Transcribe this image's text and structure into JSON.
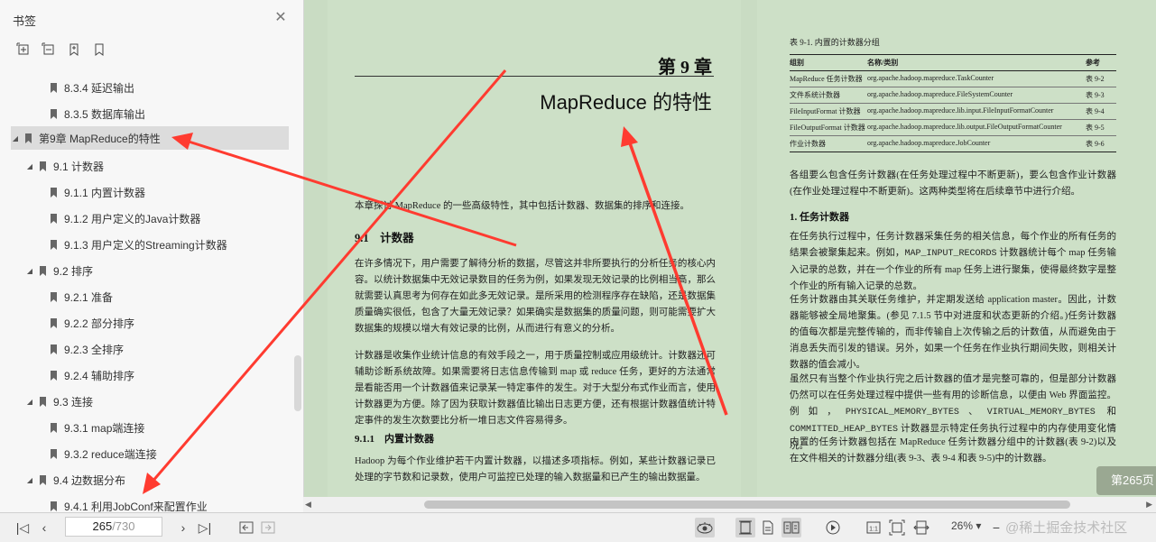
{
  "sidebar": {
    "title": "书签",
    "items": [
      {
        "label": "8.3.4 延迟输出",
        "level": 2,
        "expanded": null,
        "selected": false
      },
      {
        "label": "8.3.5 数据库输出",
        "level": 2,
        "expanded": null,
        "selected": false
      },
      {
        "label": "第9章 MapReduce的特性",
        "level": 0,
        "expanded": true,
        "selected": true
      },
      {
        "label": "9.1 计数器",
        "level": 1,
        "expanded": true,
        "selected": false
      },
      {
        "label": "9.1.1 内置计数器",
        "level": 2,
        "expanded": null,
        "selected": false
      },
      {
        "label": "9.1.2 用户定义的Java计数器",
        "level": 2,
        "expanded": null,
        "selected": false
      },
      {
        "label": "9.1.3 用户定义的Streaming计数器",
        "level": 2,
        "expanded": null,
        "selected": false
      },
      {
        "label": "9.2 排序",
        "level": 1,
        "expanded": true,
        "selected": false
      },
      {
        "label": "9.2.1 准备",
        "level": 2,
        "expanded": null,
        "selected": false
      },
      {
        "label": "9.2.2 部分排序",
        "level": 2,
        "expanded": null,
        "selected": false
      },
      {
        "label": "9.2.3 全排序",
        "level": 2,
        "expanded": null,
        "selected": false
      },
      {
        "label": "9.2.4 辅助排序",
        "level": 2,
        "expanded": null,
        "selected": false
      },
      {
        "label": "9.3 连接",
        "level": 1,
        "expanded": true,
        "selected": false
      },
      {
        "label": "9.3.1 map端连接",
        "level": 2,
        "expanded": null,
        "selected": false
      },
      {
        "label": "9.3.2 reduce端连接",
        "level": 2,
        "expanded": null,
        "selected": false
      },
      {
        "label": "9.4 边数据分布",
        "level": 1,
        "expanded": true,
        "selected": false
      },
      {
        "label": "9.4.1 利用JobConf来配置作业",
        "level": 2,
        "expanded": null,
        "selected": false
      }
    ]
  },
  "left_page": {
    "chapter_number": "第 9 章",
    "chapter_title": "MapReduce 的特性",
    "intro": "本章探讨 MapReduce 的一些高级特性，其中包括计数器、数据集的排序和连接。",
    "section_num": "9.1",
    "section_title": "计数器",
    "p1": "在许多情况下，用户需要了解待分析的数据，尽管这并非所要执行的分析任务的核心内容。以统计数据集中无效记录数目的任务为例，如果发现无效记录的比例相当高，那么就需要认真思考为何存在如此多无效记录。是所采用的检测程序存在缺陷，还是数据集质量确实很低，包含了大量无效记录？如果确实是数据集的质量问题，则可能需要扩大数据集的规模以增大有效记录的比例，从而进行有意义的分析。",
    "p2": "计数器是收集作业统计信息的有效手段之一，用于质量控制或应用级统计。计数器还可辅助诊断系统故障。如果需要将日志信息传输到 map 或 reduce 任务，更好的方法通常是看能否用一个计数器值来记录某一特定事件的发生。对于大型分布式作业而言，使用计数器更为方便。除了因为获取计数器值比输出日志更方便，还有根据计数器值统计特定事件的发生次数要比分析一堆日志文件容易得多。",
    "subsection_num": "9.1.1",
    "subsection_title": "内置计数器",
    "p3": "Hadoop 为每个作业维护若干内置计数器，以描述多项指标。例如，某些计数器记录已处理的字节数和记录数，使用户可监控已处理的输入数据量和已产生的输出数据量。"
  },
  "right_page": {
    "table_caption": "表 9-1. 内置的计数器分组",
    "table_headers": [
      "组别",
      "名称/类别",
      "参考"
    ],
    "table_rows": [
      [
        "MapReduce 任务计数器",
        "org.apache.hadoop.mapreduce.TaskCounter",
        "表 9-2"
      ],
      [
        "文件系统计数器",
        "org.apache.hadoop.mapreduce.FileSystemCounter",
        "表 9-3"
      ],
      [
        "FileInputFormat 计数器",
        "org.apache.hadoop.mapreduce.lib.input.FileInputFormatCounter",
        "表 9-4"
      ],
      [
        "FileOutputFormat 计数器",
        "org.apache.hadoop.mapreduce.lib.output.FileOutputFormatCounter",
        "表 9-5"
      ],
      [
        "作业计数器",
        "org.apache.hadoop.mapreduce.JobCounter",
        "表 9-6"
      ]
    ],
    "p1": "各组要么包含任务计数器(在任务处理过程中不断更新)，要么包含作业计数器(在作业处理过程中不断更新)。这两种类型将在后续章节中进行介绍。",
    "heading1": "1. 任务计数器",
    "p2a": "在任务执行过程中，任务计数器采集任务的相关信息，每个作业的所有任务的结果会被聚集起来。例如，",
    "p2_code": "MAP_INPUT_RECORDS",
    "p2b": " 计数器统计每个 map 任务输入记录的总数，并在一个作业的所有 map 任务上进行聚集，使得最终数字是整个作业的所有输入记录的总数。",
    "p3": "任务计数器由其关联任务维护，并定期发送给 application master。因此，计数器能够被全局地聚集。(参见 7.1.5 节中对进度和状态更新的介绍。)任务计数器的值每次都是完整传输的，而非传输自上次传输之后的计数值，从而避免由于消息丢失而引发的错误。另外，如果一个任务在作业执行期间失败，则相关计数器的值会减小。",
    "p4a": "虽然只有当整个作业执行完之后计数器的值才是完整可靠的，但是部分计数器仍然可以在任务处理过程中提供一些有用的诊断信息，以便由 Web 界面监控。例如，",
    "p4_code1": "PHYSICAL_MEMORY_BYTES",
    "p4_sep1": "、",
    "p4_code2": "VIRTUAL_MEMORY_BYTES",
    "p4_sep2": " 和 ",
    "p4_code3": "COMMITTED_HEAP_BYTES",
    "p4b": " 计数器显示特定任务执行过程中的内存使用变化情况。",
    "p5": "内置的任务计数器包括在 MapReduce 任务计数器分组中的计数器(表 9-2)以及在文件相关的计数器分组(表 9-3、表 9-4 和表 9-5)中的计数器。"
  },
  "page_badge": "第265页",
  "toolbar": {
    "current_page": "265",
    "total_pages": "/730",
    "zoom": "26%",
    "watermark": "@稀土掘金技术社区"
  },
  "colors": {
    "page_bg": "#cde0c7",
    "arrow": "#ff3b30",
    "sidebar_bg": "#f7f7f7"
  }
}
